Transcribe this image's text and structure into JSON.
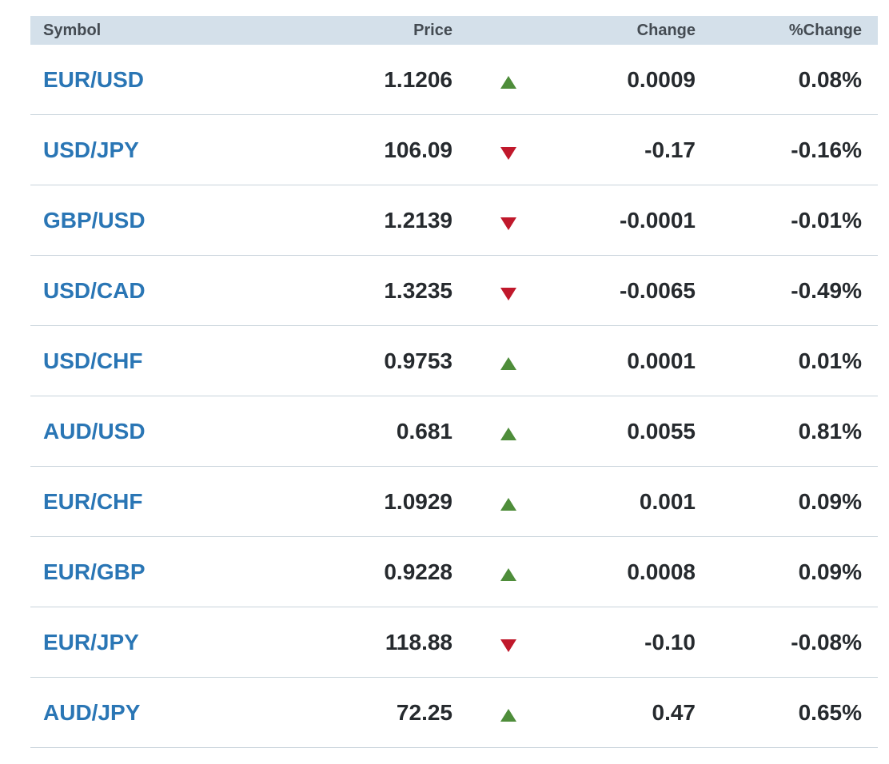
{
  "header": {
    "symbol": "Symbol",
    "price": "Price",
    "change": "Change",
    "pct_change": "%Change"
  },
  "colors": {
    "up": "#4e8d3a",
    "down": "#c0182b",
    "link": "#2a76b5",
    "header_bg": "#d4e0ea"
  },
  "rows": [
    {
      "symbol": "EUR/USD",
      "price": "1.1206",
      "direction": "up",
      "change": "0.0009",
      "pct": "0.08%"
    },
    {
      "symbol": "USD/JPY",
      "price": "106.09",
      "direction": "down",
      "change": "-0.17",
      "pct": "-0.16%"
    },
    {
      "symbol": "GBP/USD",
      "price": "1.2139",
      "direction": "down",
      "change": "-0.0001",
      "pct": "-0.01%"
    },
    {
      "symbol": "USD/CAD",
      "price": "1.3235",
      "direction": "down",
      "change": "-0.0065",
      "pct": "-0.49%"
    },
    {
      "symbol": "USD/CHF",
      "price": "0.9753",
      "direction": "up",
      "change": "0.0001",
      "pct": "0.01%"
    },
    {
      "symbol": "AUD/USD",
      "price": "0.681",
      "direction": "up",
      "change": "0.0055",
      "pct": "0.81%"
    },
    {
      "symbol": "EUR/CHF",
      "price": "1.0929",
      "direction": "up",
      "change": "0.001",
      "pct": "0.09%"
    },
    {
      "symbol": "EUR/GBP",
      "price": "0.9228",
      "direction": "up",
      "change": "0.0008",
      "pct": "0.09%"
    },
    {
      "symbol": "EUR/JPY",
      "price": "118.88",
      "direction": "down",
      "change": "-0.10",
      "pct": "-0.08%"
    },
    {
      "symbol": "AUD/JPY",
      "price": "72.25",
      "direction": "up",
      "change": "0.47",
      "pct": "0.65%"
    }
  ]
}
